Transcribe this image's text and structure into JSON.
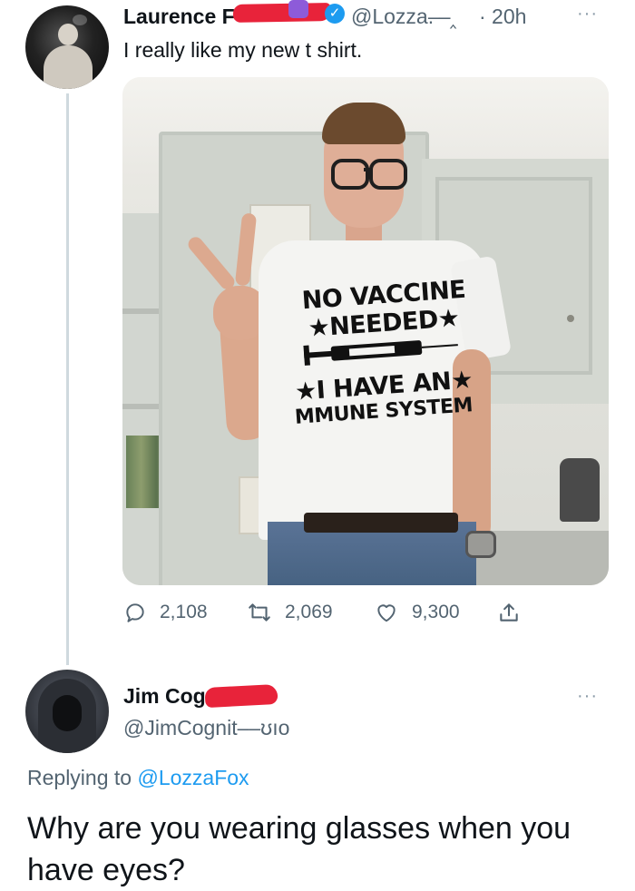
{
  "tweet": {
    "author_name": "Laurence F",
    "author_handle": "@Lozza.",
    "handle_tail": "––‸",
    "time": "· 20h",
    "text": "I really like my new t shirt.",
    "image": {
      "shirt_line1": "NO VACCINE",
      "shirt_line2": "★NEEDED★",
      "shirt_line3": "★I HAVE AN★",
      "shirt_line4": "MMUNE SYSTEM"
    },
    "stats": {
      "replies": "2,108",
      "retweets": "2,069",
      "likes": "9,300"
    },
    "more_label": "···"
  },
  "reply": {
    "author_name": "Jim Cogn",
    "author_handle": "@JimCognit––ʊıo",
    "replying_to_prefix": "Replying to ",
    "replying_to_handle": "@LozzaFox",
    "text": "Why are you wearing glasses when you have eyes?",
    "more_label": "···"
  },
  "colors": {
    "accent": "#1d9bf0",
    "muted": "#536471",
    "redaction": "#e8233a",
    "thread_line": "#cfd9de"
  }
}
